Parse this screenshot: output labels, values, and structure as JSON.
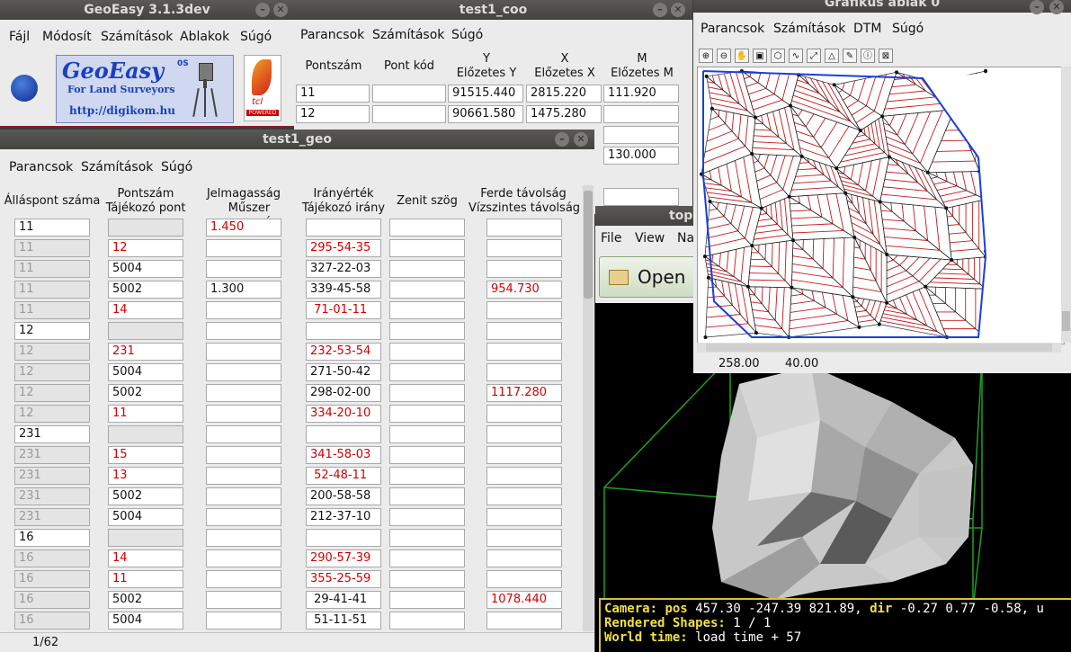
{
  "geoeasy": {
    "title": "GeoEasy 3.1.3dev",
    "menu": [
      "Fájl",
      "Módosít",
      "Számítások",
      "Ablakok",
      "Súgó"
    ],
    "logo_title": "GeoEasy",
    "logo_version": "0S",
    "logo_subtitle": "For Land Surveyors",
    "logo_url": "http://digikom.hu",
    "tcl_caption": "tcl",
    "tcl_powered": "POWERED"
  },
  "coo": {
    "title": "test1_coo",
    "menu": [
      "Parancsok",
      "Számítások",
      "Súgó"
    ],
    "headers": {
      "pontszam": "Pontszám",
      "pontkod": "Pont kód",
      "y": "Y",
      "y2": "Előzetes Y",
      "x": "X",
      "x2": "Előzetes X",
      "m": "M",
      "m2": "Előzetes M"
    },
    "rows": [
      {
        "pont": "11",
        "kod": "",
        "y": "91515.440",
        "x": "2815.220",
        "m": "111.920"
      },
      {
        "pont": "12",
        "kod": "",
        "y": "90661.580",
        "x": "1475.280",
        "m": ""
      }
    ],
    "extra_m": "130.000"
  },
  "geo": {
    "title": "test1_geo",
    "menu": [
      "Parancsok",
      "Számítások",
      "Súgó"
    ],
    "headers": {
      "allaspont": "Álláspont száma",
      "pontszam1": "Pontszám",
      "pontszam2": "Tájékozó pont",
      "jel1": "Jelmagasság",
      "jel2": "Műszer magasság",
      "irany1": "Irányérték",
      "irany2": "Tájékozó irány",
      "zenit": "Zenit szög",
      "ferde1": "Ferde távolság",
      "ferde2": "Vízszintes távolság"
    },
    "status": "1/62",
    "rows": [
      {
        "st": "11",
        "stg": false,
        "pt": "",
        "ptr": false,
        "h": "1.450",
        "hr": true,
        "dir": "",
        "dirr": false,
        "dist": "",
        "distr": false
      },
      {
        "st": "11",
        "stg": true,
        "pt": "12",
        "ptr": true,
        "h": "",
        "hr": false,
        "dir": "295-54-35",
        "dirr": true,
        "dist": "",
        "distr": false
      },
      {
        "st": "11",
        "stg": true,
        "pt": "5004",
        "ptr": false,
        "h": "",
        "hr": false,
        "dir": "327-22-03",
        "dirr": false,
        "dist": "",
        "distr": false
      },
      {
        "st": "11",
        "stg": true,
        "pt": "5002",
        "ptr": false,
        "h": "1.300",
        "hr": false,
        "dir": "339-45-58",
        "dirr": false,
        "dist": "954.730",
        "distr": true
      },
      {
        "st": "11",
        "stg": true,
        "pt": "14",
        "ptr": true,
        "h": "",
        "hr": false,
        "dir": " 71-01-11",
        "dirr": true,
        "dist": "",
        "distr": false
      },
      {
        "st": "12",
        "stg": false,
        "pt": "",
        "ptr": false,
        "h": "",
        "hr": false,
        "dir": "",
        "dirr": false,
        "dist": "",
        "distr": false
      },
      {
        "st": "12",
        "stg": true,
        "pt": "231",
        "ptr": true,
        "h": "",
        "hr": false,
        "dir": "232-53-54",
        "dirr": true,
        "dist": "",
        "distr": false
      },
      {
        "st": "12",
        "stg": true,
        "pt": "5004",
        "ptr": false,
        "h": "",
        "hr": false,
        "dir": "271-50-42",
        "dirr": false,
        "dist": "",
        "distr": false
      },
      {
        "st": "12",
        "stg": true,
        "pt": "5002",
        "ptr": false,
        "h": "",
        "hr": false,
        "dir": "298-02-00",
        "dirr": false,
        "dist": "1117.280",
        "distr": true
      },
      {
        "st": "12",
        "stg": true,
        "pt": "11",
        "ptr": true,
        "h": "",
        "hr": false,
        "dir": "334-20-10",
        "dirr": true,
        "dist": "",
        "distr": false
      },
      {
        "st": "231",
        "stg": false,
        "pt": "",
        "ptr": false,
        "h": "",
        "hr": false,
        "dir": "",
        "dirr": false,
        "dist": "",
        "distr": false
      },
      {
        "st": "231",
        "stg": true,
        "pt": "15",
        "ptr": true,
        "h": "",
        "hr": false,
        "dir": "341-58-03",
        "dirr": true,
        "dist": "",
        "distr": false
      },
      {
        "st": "231",
        "stg": true,
        "pt": "13",
        "ptr": true,
        "h": "",
        "hr": false,
        "dir": " 52-48-11",
        "dirr": true,
        "dist": "",
        "distr": false
      },
      {
        "st": "231",
        "stg": true,
        "pt": "5002",
        "ptr": false,
        "h": "",
        "hr": false,
        "dir": "200-58-58",
        "dirr": false,
        "dist": "",
        "distr": false
      },
      {
        "st": "231",
        "stg": true,
        "pt": "5004",
        "ptr": false,
        "h": "",
        "hr": false,
        "dir": "212-37-10",
        "dirr": false,
        "dist": "",
        "distr": false
      },
      {
        "st": "16",
        "stg": false,
        "pt": "",
        "ptr": false,
        "h": "",
        "hr": false,
        "dir": "",
        "dirr": false,
        "dist": "",
        "distr": false
      },
      {
        "st": "16",
        "stg": true,
        "pt": "14",
        "ptr": true,
        "h": "",
        "hr": false,
        "dir": "290-57-39",
        "dirr": true,
        "dist": "",
        "distr": false
      },
      {
        "st": "16",
        "stg": true,
        "pt": "11",
        "ptr": true,
        "h": "",
        "hr": false,
        "dir": "355-25-59",
        "dirr": true,
        "dist": "",
        "distr": false
      },
      {
        "st": "16",
        "stg": true,
        "pt": "5002",
        "ptr": false,
        "h": "",
        "hr": false,
        "dir": " 29-41-41",
        "dirr": false,
        "dist": "1078.440",
        "distr": true
      },
      {
        "st": "16",
        "stg": true,
        "pt": "5004",
        "ptr": false,
        "h": "",
        "hr": false,
        "dir": " 51-11-51",
        "dirr": false,
        "dist": "",
        "distr": false
      }
    ]
  },
  "viewer": {
    "title": "top",
    "menu": [
      "File",
      "View",
      "Na"
    ],
    "open_label": "Open",
    "camera_label": "Camera:",
    "camera_pos_label": "pos",
    "camera_pos": "457.30 -247.39 821.89,",
    "camera_dir_label": "dir",
    "camera_dir": "-0.27 0.77 -0.58, u",
    "shapes_label": "Rendered Shapes:",
    "shapes_value": "1 / 1",
    "time_label": "World time:",
    "time_value": "load time + 57"
  },
  "graph": {
    "title": "Grafikus ablak 0",
    "menu": [
      "Parancsok",
      "Számítások",
      "DTM",
      "Súgó"
    ],
    "coord_x": "258.00",
    "coord_y": "40.00",
    "tools": [
      "zoom-in-icon",
      "zoom-out-icon",
      "pan-icon",
      "zoom-all-icon",
      "select-icon",
      "measure-icon",
      "line-icon",
      "triangle-icon",
      "edit-icon",
      "info-icon",
      "delete-icon"
    ]
  },
  "colors": {
    "red": "#d10000",
    "accent": "#1a3fbf"
  }
}
